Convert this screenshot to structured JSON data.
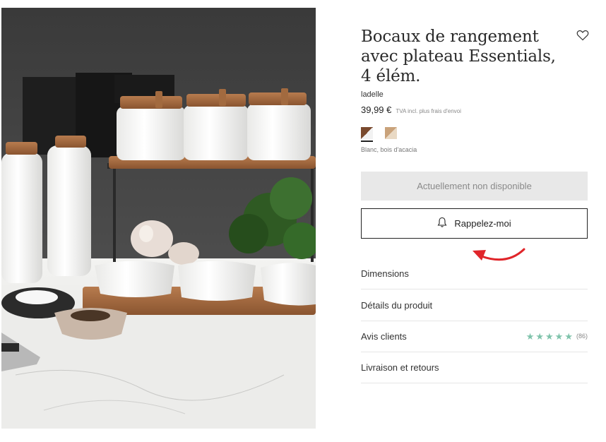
{
  "product": {
    "title": "Bocaux de rangement avec plateau Essentials, 4 élém.",
    "brand": "ladelle",
    "price": "39,99 €",
    "tax_note": "TVA incl. plus frais d'envoi",
    "color_name": "Blanc, bois d'acacia",
    "favorite_icon": "heart-outline-icon"
  },
  "buttons": {
    "unavailable_label": "Actuellement non disponible",
    "remind_label": "Rappelez-moi",
    "remind_icon": "bell-icon"
  },
  "accordion": {
    "items": [
      {
        "label": "Dimensions"
      },
      {
        "label": "Détails du produit"
      },
      {
        "label": "Avis clients",
        "rating_stars": 5,
        "review_count": "(86)"
      },
      {
        "label": "Livraison et retours"
      }
    ]
  },
  "colors": {
    "star": "#7fc3ab",
    "annotation_arrow": "#e0252a",
    "button_disabled_bg": "#e8e8e8"
  }
}
